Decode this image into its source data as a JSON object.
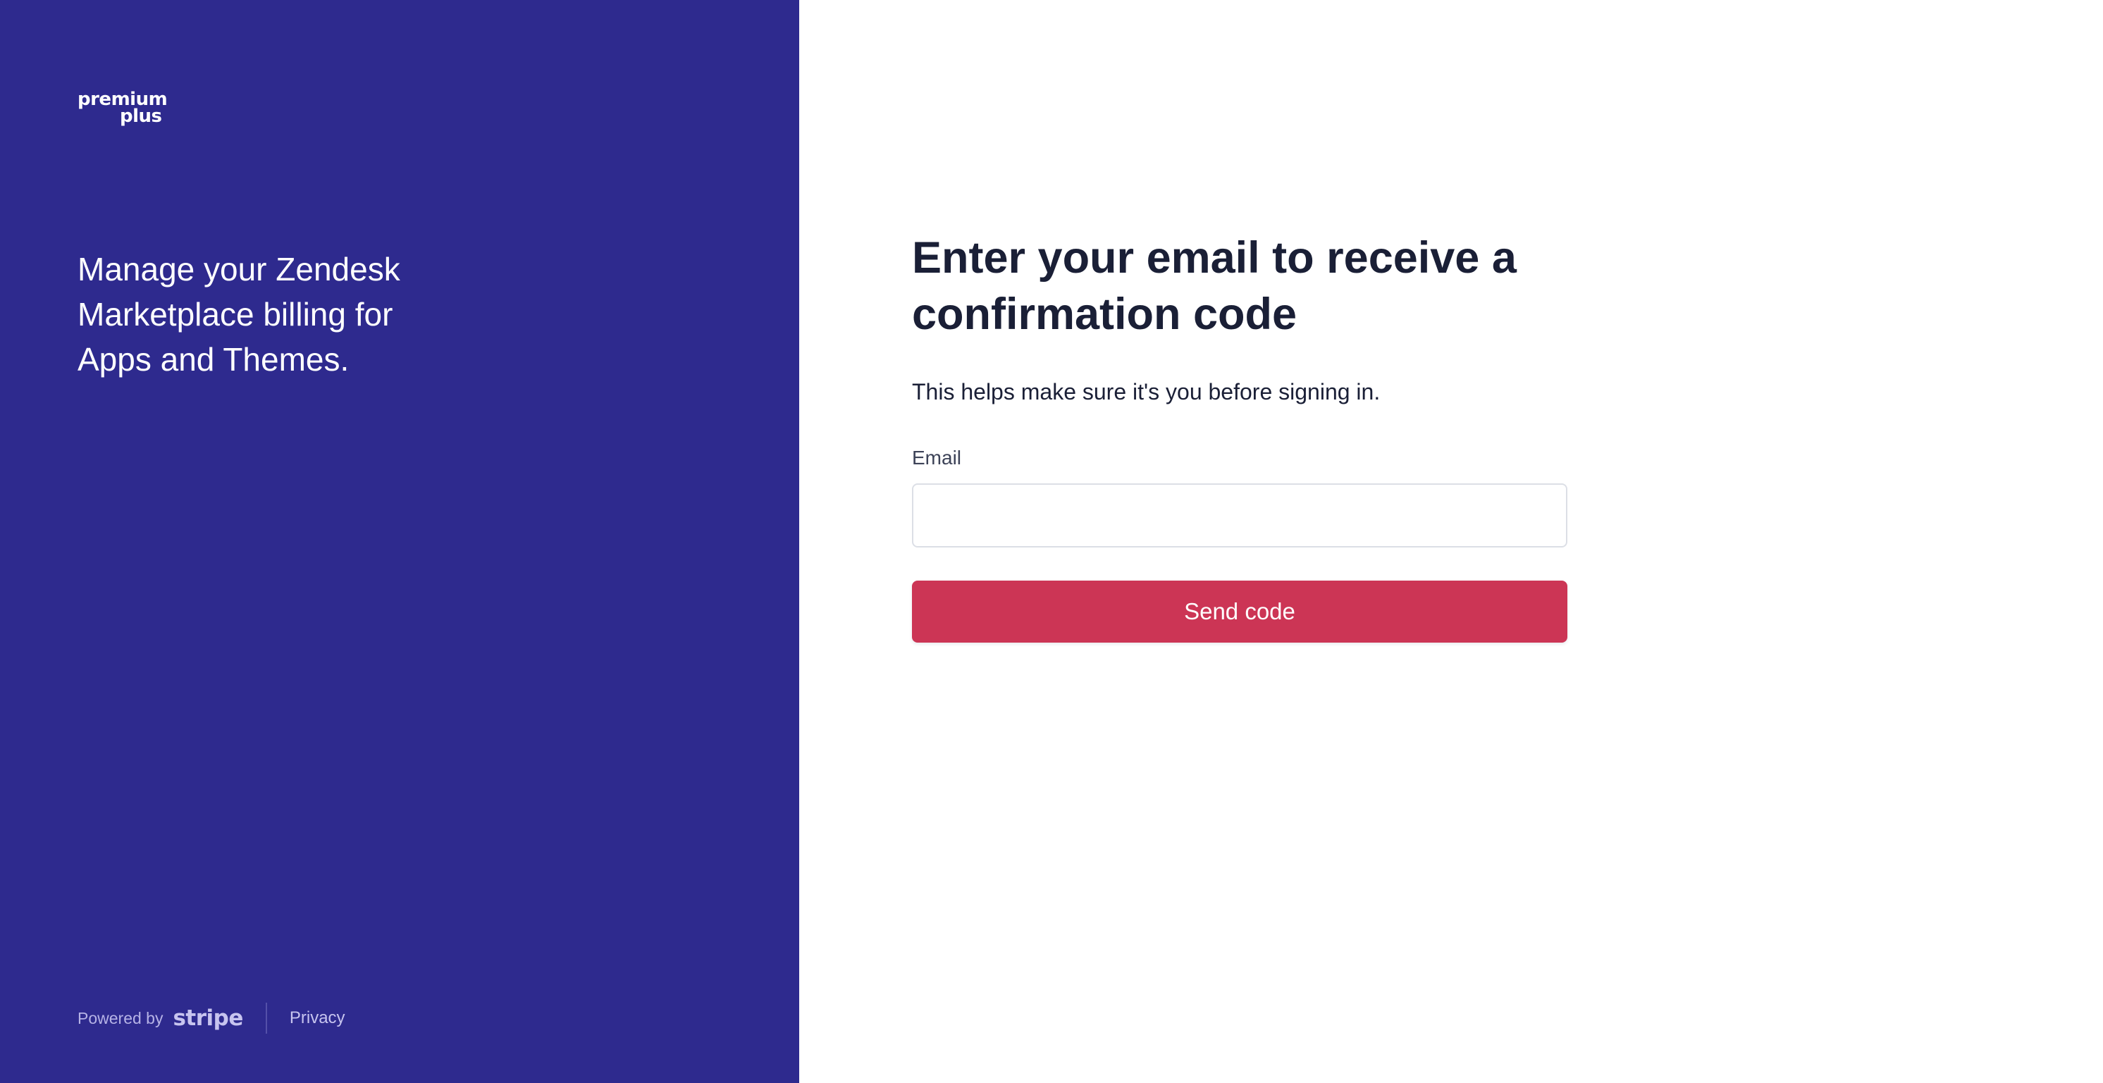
{
  "brand": {
    "logo_line1": "premium",
    "logo_line2": "plus",
    "panel_color": "#2e2a8e"
  },
  "left_panel": {
    "tagline": "Manage your Zendesk Marketplace billing for Apps and Themes."
  },
  "footer": {
    "powered_by": "Powered by",
    "provider": "stripe",
    "privacy_link": "Privacy"
  },
  "form": {
    "heading": "Enter your email to receive a confirmation code",
    "subtext": "This helps make sure it's you before signing in.",
    "email_label": "Email",
    "email_value": "",
    "email_placeholder": "",
    "submit_label": "Send code",
    "submit_color": "#cc3555"
  }
}
